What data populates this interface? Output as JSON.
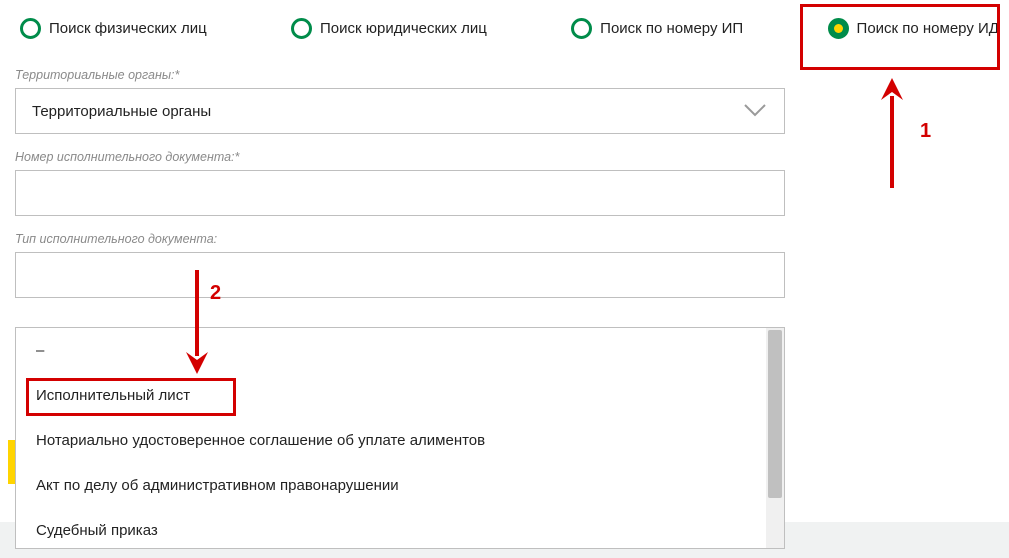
{
  "radios": {
    "opt1": "Поиск физических лиц",
    "opt2": "Поиск юридических лиц",
    "opt3": "Поиск по номеру ИП",
    "opt4": "Поиск по номеру ИД"
  },
  "fields": {
    "territory_label": "Территориальные органы:*",
    "territory_value": "Территориальные органы",
    "docnum_label": "Номер исполнительного документа:*",
    "docnum_value": "",
    "doctype_label": "Тип исполнительного документа:",
    "doctype_value": ""
  },
  "dropdown": {
    "item0": "–",
    "item1": "Исполнительный лист",
    "item2": "Нотариально удостоверенное соглашение об уплате алиментов",
    "item3": "Акт по делу об административном правонарушении",
    "item4": "Судебный приказ"
  },
  "annotations": {
    "num1": "1",
    "num2": "2"
  }
}
